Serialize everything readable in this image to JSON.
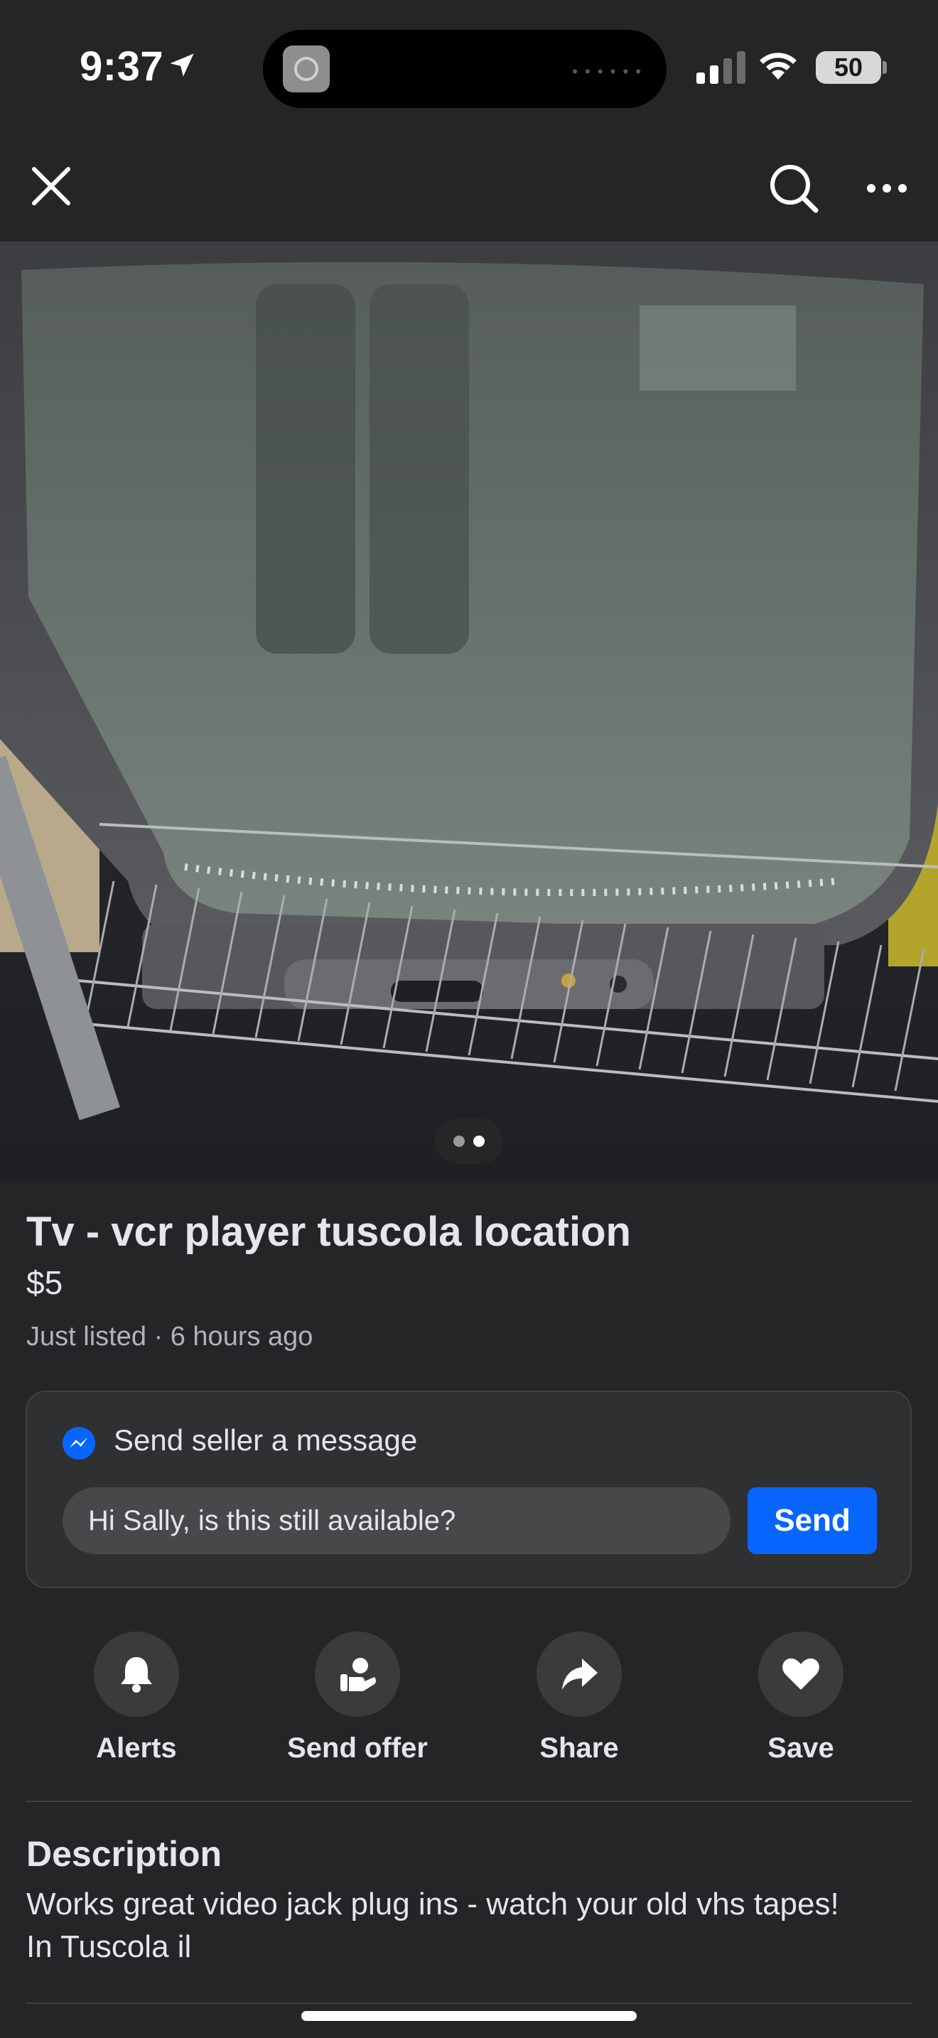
{
  "status_bar": {
    "time": "9:37",
    "battery": "50",
    "icons": [
      "location-arrow-icon",
      "signal-bars-icon",
      "wifi-icon",
      "battery-icon"
    ]
  },
  "top_nav": {
    "icons": [
      "close-icon",
      "search-icon",
      "more-horizontal-icon"
    ]
  },
  "listing": {
    "photo": {
      "description": "Gray CRT TV-VCR combination on a wire shelf",
      "pagination": {
        "total": 2,
        "active": 2
      }
    },
    "title": "Tv - vcr player tuscola location",
    "price": "$5",
    "meta": "Just listed · 6 hours ago"
  },
  "message_card": {
    "heading": "Send seller a message",
    "input_value": "Hi Sally, is this still available?",
    "send_label": "Send"
  },
  "actions": [
    {
      "label": "Alerts",
      "icon": "bell-icon"
    },
    {
      "label": "Send offer",
      "icon": "send-offer-icon"
    },
    {
      "label": "Share",
      "icon": "share-arrow-icon"
    },
    {
      "label": "Save",
      "icon": "heart-icon"
    }
  ],
  "description": {
    "title": "Description",
    "body": "Works great  video jack plug ins - watch your old vhs tapes!\nIn Tuscola il"
  },
  "colors": {
    "background": "#242526",
    "accent": "#0866ff",
    "card": "#2f3031",
    "muted_text": "#b0b3b8"
  }
}
